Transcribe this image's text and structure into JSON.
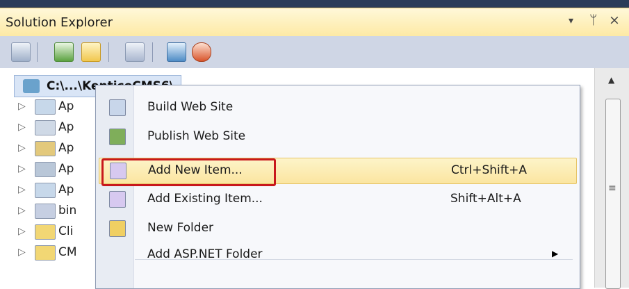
{
  "panel": {
    "title": "Solution Explorer",
    "pin_glyph": "▾",
    "pushpin_glyph": "ᛘ",
    "close_glyph": "×"
  },
  "toolbar": {
    "icons": [
      "properties-icon",
      "refresh-icon",
      "nest-related-files-icon",
      "view-class-diagram-icon",
      "copy-website-icon",
      "aspnet-configuration-icon"
    ]
  },
  "tree": {
    "root_label": "C:\\...\\KenticoCMS6\\",
    "rows": [
      {
        "label": "Ap",
        "icon": "folder-app-code-icon",
        "color": "#c7d8ea"
      },
      {
        "label": "Ap",
        "icon": "folder-app-data-icon",
        "color": "#cfd9e6"
      },
      {
        "label": "Ap",
        "icon": "folder-app-browsers-icon",
        "color": "#e3c97c"
      },
      {
        "label": "Ap",
        "icon": "folder-app-theme-icon",
        "color": "#b9c7d8"
      },
      {
        "label": "Ap",
        "icon": "folder-app-webref-icon",
        "color": "#c7d8ea"
      },
      {
        "label": "bin",
        "icon": "folder-bin-icon",
        "color": "#c6cfe2"
      },
      {
        "label": "Cli",
        "icon": "folder-icon",
        "color": "#f2d774"
      },
      {
        "label": "CM",
        "icon": "folder-icon",
        "color": "#f2d774"
      }
    ],
    "expander_glyph": "▷"
  },
  "context_menu": {
    "items": [
      {
        "label": "Build Web Site",
        "shortcut": "",
        "icon": "build-icon",
        "color": "#c8d6ea"
      },
      {
        "label": "Publish Web Site",
        "shortcut": "",
        "icon": "publish-icon",
        "color": "#7fae5a"
      },
      {
        "label": "Add New Item...",
        "shortcut": "Ctrl+Shift+A",
        "icon": "add-new-item-icon",
        "color": "#d7c9f0",
        "highlighted": true
      },
      {
        "label": "Add Existing Item...",
        "shortcut": "Shift+Alt+A",
        "icon": "add-existing-item-icon",
        "color": "#d7c9f0"
      },
      {
        "label": "New Folder",
        "shortcut": "",
        "icon": "new-folder-icon",
        "color": "#f0cf62"
      },
      {
        "label": "Add ASP.NET Folder",
        "shortcut": "",
        "icon": "",
        "color": "",
        "submenu_glyph": "▶"
      }
    ],
    "highlight_color": "#c8181c"
  },
  "scrollbar": {
    "up_glyph": "▲",
    "grip_glyph": "≡"
  }
}
